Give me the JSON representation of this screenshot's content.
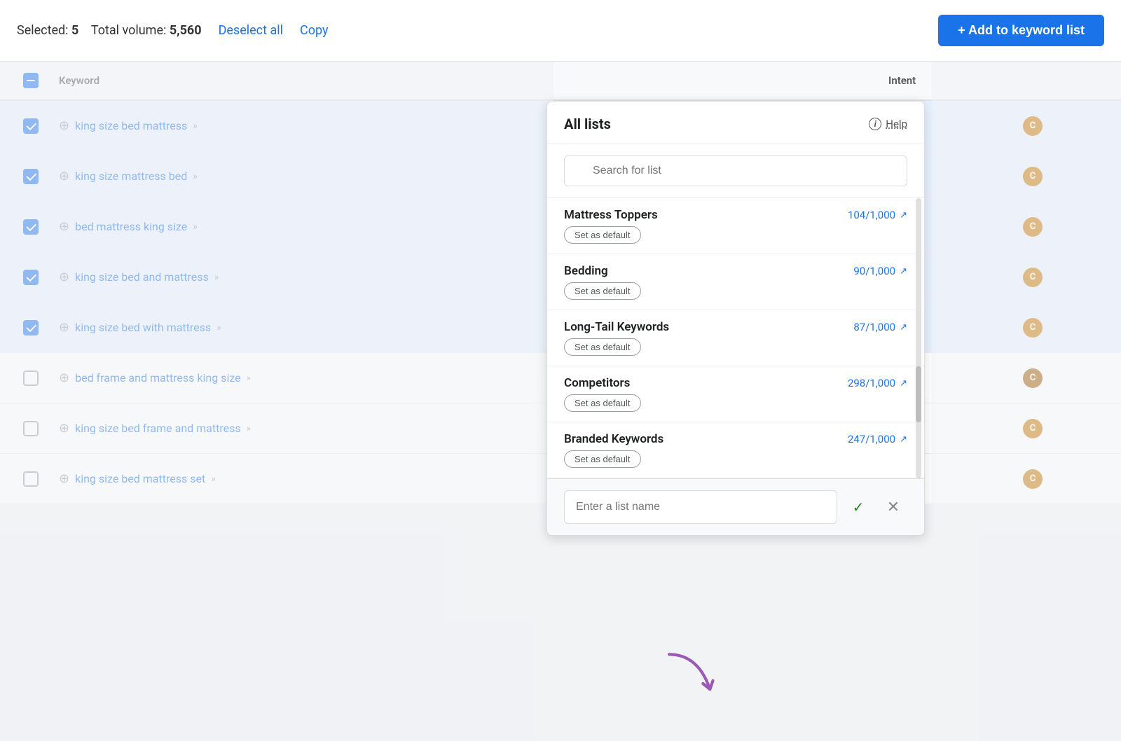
{
  "topbar": {
    "selected_label": "Selected:",
    "selected_count": "5",
    "total_volume_label": "Total volume:",
    "total_volume_value": "5,560",
    "deselect_all_label": "Deselect all",
    "copy_label": "Copy",
    "add_to_list_label": "+ Add to keyword list"
  },
  "table": {
    "header": {
      "keyword_col": "Keyword",
      "intent_col": "Intent"
    },
    "rows": [
      {
        "id": 1,
        "checked": true,
        "keyword": "king size bed mattress",
        "intent": "C",
        "selected": true
      },
      {
        "id": 2,
        "checked": true,
        "keyword": "king size mattress bed",
        "intent": "C",
        "selected": true
      },
      {
        "id": 3,
        "checked": true,
        "keyword": "bed mattress king size",
        "intent": "C",
        "selected": true
      },
      {
        "id": 4,
        "checked": true,
        "keyword": "king size bed and mattress",
        "intent": "C",
        "selected": true
      },
      {
        "id": 5,
        "checked": true,
        "keyword": "king size bed with mattress",
        "intent": "C",
        "selected": true
      },
      {
        "id": 6,
        "checked": false,
        "keyword": "bed frame and mattress king size",
        "intent": "C",
        "selected": false
      },
      {
        "id": 7,
        "checked": false,
        "keyword": "king size bed frame and mattress",
        "intent": "C",
        "selected": false
      },
      {
        "id": 8,
        "checked": false,
        "keyword": "king size bed mattress set",
        "intent": "C",
        "selected": false
      }
    ]
  },
  "dropdown": {
    "title": "All lists",
    "help_label": "Help",
    "search_placeholder": "Search for list",
    "lists": [
      {
        "id": 1,
        "name": "Mattress Toppers",
        "count": "104/1,000",
        "set_default": "Set as default"
      },
      {
        "id": 2,
        "name": "Bedding",
        "count": "90/1,000",
        "set_default": "Set as default"
      },
      {
        "id": 3,
        "name": "Long-Tail Keywords",
        "count": "87/1,000",
        "set_default": "Set as default"
      },
      {
        "id": 4,
        "name": "Competitors",
        "count": "298/1,000",
        "set_default": "Set as default"
      },
      {
        "id": 5,
        "name": "Branded Keywords",
        "count": "247/1,000",
        "set_default": "Set as default"
      }
    ],
    "new_list_placeholder": "Enter a list name",
    "confirm_icon": "✓",
    "cancel_icon": "✕"
  }
}
